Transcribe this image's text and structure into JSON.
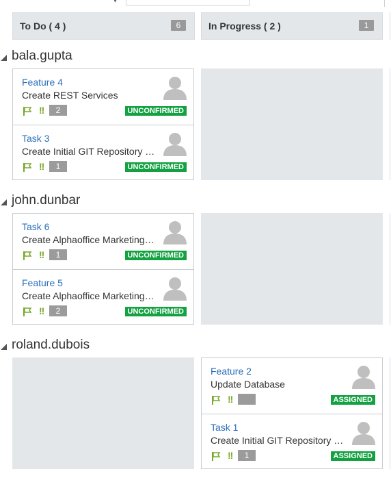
{
  "columns": [
    {
      "title": "To Do ( 4 )",
      "count": "6"
    },
    {
      "title": "In Progress ( 2 )",
      "count": "1"
    }
  ],
  "lanes": [
    {
      "name": "bala.gupta",
      "cards": [
        {
          "title": "Feature 4",
          "description": "Create REST Services",
          "points": "2",
          "status": "UNCONFIRMED"
        },
        {
          "title": "Task 3",
          "description": "Create Initial GIT Repository for...",
          "points": "1",
          "status": "UNCONFIRMED"
        }
      ]
    },
    {
      "name": "john.dunbar",
      "cards": [
        {
          "title": "Task 6",
          "description": "Create Alphaoffice Marketing UI",
          "points": "1",
          "status": "UNCONFIRMED"
        },
        {
          "title": "Feature 5",
          "description": "Create Alphaoffice Marketing UI",
          "points": "2",
          "status": "UNCONFIRMED"
        }
      ]
    },
    {
      "name": "roland.dubois",
      "cards": [
        {
          "title": "Feature 2",
          "description": "Update Database",
          "points": "",
          "status": "ASSIGNED"
        },
        {
          "title": "Task 1",
          "description": "Create Initial GIT Repository for...",
          "points": "1",
          "status": "ASSIGNED"
        }
      ]
    }
  ],
  "icons": {
    "avatar": "user-avatar-icon",
    "flag": "flag-icon",
    "priority": "priority-icon",
    "collapse": "collapse-triangle-icon"
  },
  "colors": {
    "column_header_bg": "#e4e7ea",
    "count_badge": "#999999",
    "link": "#2a6ebb",
    "status_green": "#13a142",
    "flag_green": "#7aa82c"
  }
}
